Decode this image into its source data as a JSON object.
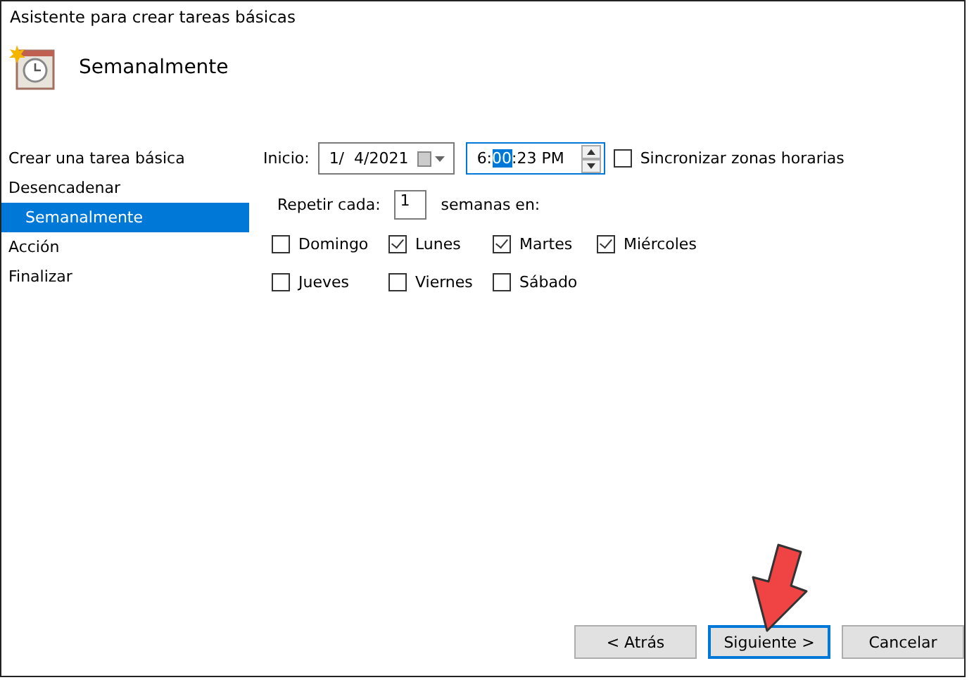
{
  "window": {
    "title": "Asistente para crear tareas básicas"
  },
  "header": {
    "title": "Semanalmente"
  },
  "nav": [
    {
      "label": "Crear una tarea básica",
      "selected": false
    },
    {
      "label": "Desencadenar",
      "selected": false,
      "children": [
        {
          "label": "Semanalmente",
          "selected": true
        }
      ]
    },
    {
      "label": "Acción",
      "selected": false
    },
    {
      "label": "Finalizar",
      "selected": false
    }
  ],
  "start": {
    "label": "Inicio:",
    "date": "1/  4/2021",
    "time_before": "6:",
    "time_selected": "00",
    "time_after": ":23 PM",
    "sync": {
      "label": "Sincronizar zonas horarias",
      "checked": false
    }
  },
  "repeat": {
    "label": "Repetir cada:",
    "value": "1",
    "suffix": "semanas en:"
  },
  "days": [
    [
      {
        "label": "Domingo",
        "checked": false
      },
      {
        "label": "Lunes",
        "checked": true
      },
      {
        "label": "Martes",
        "checked": true
      },
      {
        "label": "Miércoles",
        "checked": true
      }
    ],
    [
      {
        "label": "Jueves",
        "checked": false
      },
      {
        "label": "Viernes",
        "checked": false
      },
      {
        "label": "Sábado",
        "checked": false
      }
    ]
  ],
  "buttons": [
    {
      "label": "< Atrás",
      "default": false
    },
    {
      "label": "Siguiente >",
      "default": true
    },
    {
      "label": "Cancelar",
      "default": false
    }
  ]
}
